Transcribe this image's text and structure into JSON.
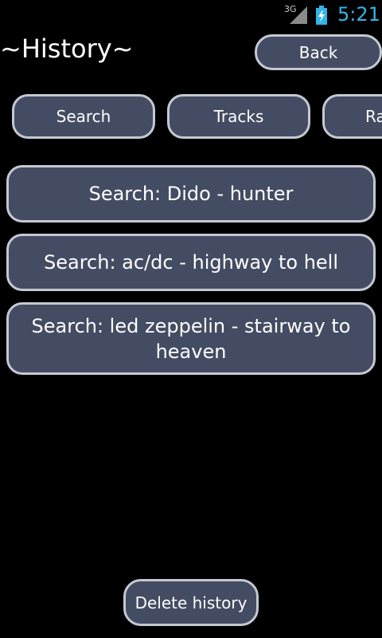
{
  "status_bar": {
    "network": "3G",
    "time": "5:21"
  },
  "header": {
    "title": "~History~",
    "back_label": "Back"
  },
  "tabs": [
    {
      "label": "Search"
    },
    {
      "label": "Tracks"
    },
    {
      "label": "Ra"
    }
  ],
  "history": {
    "items": [
      {
        "label": "Search: Dido - hunter"
      },
      {
        "label": "Search: ac/dc - highway to hell"
      },
      {
        "label": "Search: led zeppelin - stairway to heaven"
      }
    ],
    "delete_label": "Delete history"
  },
  "colors": {
    "button_fill": "#444c63",
    "button_border": "#c4c8d2",
    "clock": "#33b5e5",
    "background": "#000000"
  },
  "icons": {
    "signal": "signal-icon",
    "battery": "battery-charging-icon"
  }
}
